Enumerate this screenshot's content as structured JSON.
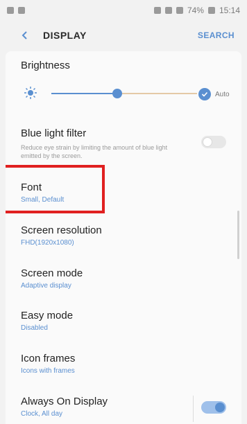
{
  "status_bar": {
    "battery": "74%",
    "time": "15:14"
  },
  "header": {
    "title": "DISPLAY",
    "search_label": "SEARCH"
  },
  "settings": {
    "brightness": {
      "title": "Brightness",
      "auto_label": "Auto",
      "level": 0.45,
      "auto_enabled": true
    },
    "blue_light": {
      "title": "Blue light filter",
      "description": "Reduce eye strain by limiting the amount of blue light emitted by the screen.",
      "enabled": false
    },
    "font": {
      "title": "Font",
      "value": "Small, Default"
    },
    "screen_resolution": {
      "title": "Screen resolution",
      "value": "FHD(1920x1080)"
    },
    "screen_mode": {
      "title": "Screen mode",
      "value": "Adaptive display"
    },
    "easy_mode": {
      "title": "Easy mode",
      "value": "Disabled"
    },
    "icon_frames": {
      "title": "Icon frames",
      "value": "Icons with frames"
    },
    "always_on_display": {
      "title": "Always On Display",
      "value": "Clock, All day",
      "enabled": true
    }
  },
  "colors": {
    "accent": "#5a8fd0",
    "highlight": "#e02020"
  }
}
